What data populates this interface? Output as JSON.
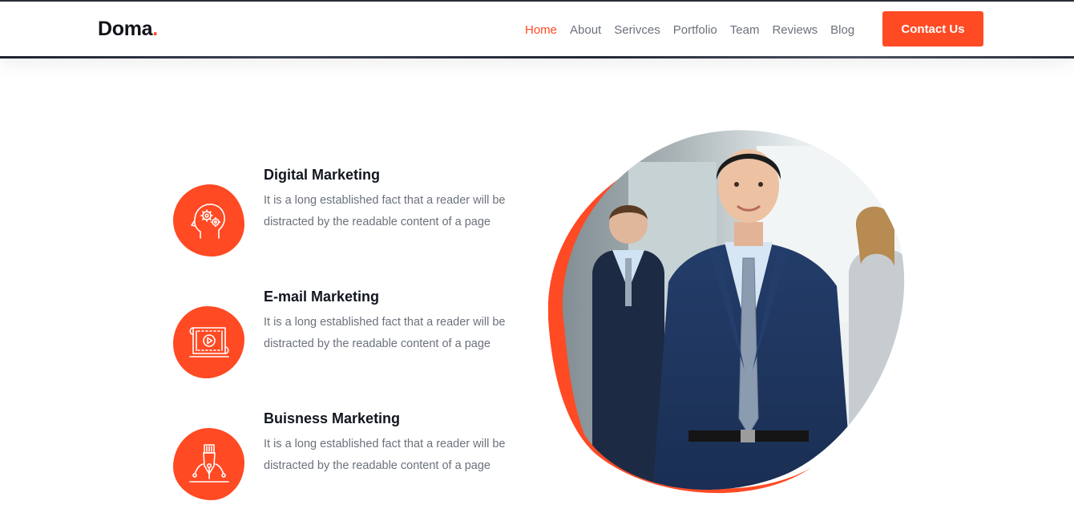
{
  "brand": {
    "name": "Doma",
    "dot": ".",
    "accent": "#ff4a24"
  },
  "nav": {
    "items": [
      "Home",
      "About",
      "Serivces",
      "Portfolio",
      "Team",
      "Reviews",
      "Blog"
    ],
    "active": "Home",
    "cta": "Contact Us"
  },
  "services": [
    {
      "title": "Digital Marketing",
      "text": "It is a long established fact that a reader will be distracted by the readable content of a page",
      "icon": "brain-gears-icon"
    },
    {
      "title": "E-mail Marketing",
      "text": "It is a long established fact that a reader will be distracted by the readable content of a page",
      "icon": "video-scroll-icon"
    },
    {
      "title": "Buisness Marketing",
      "text": "It is a long established fact that a reader will be distracted by the readable content of a page",
      "icon": "pen-nib-icon"
    }
  ],
  "hero_image": {
    "icon": "business-team-photo"
  }
}
